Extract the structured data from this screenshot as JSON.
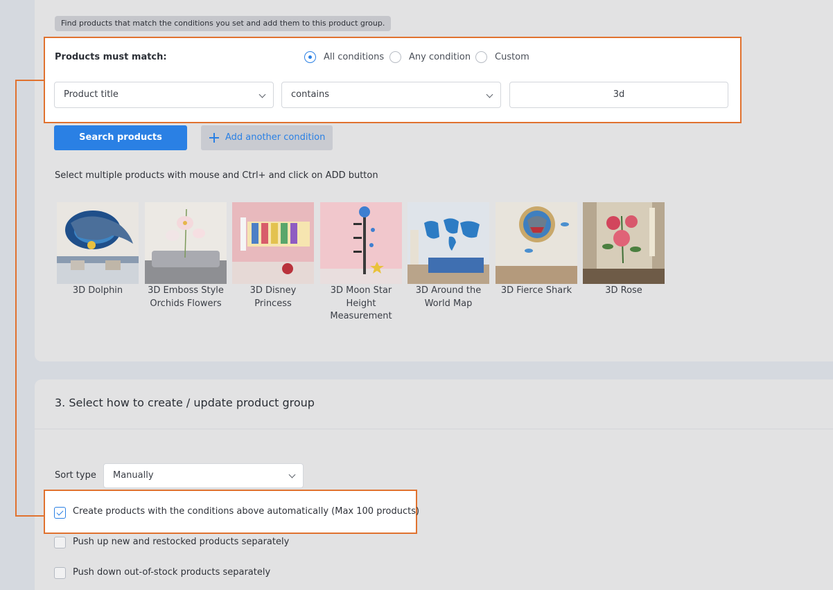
{
  "header": {
    "hint": "Find products that match the conditions you set and add them to this product group."
  },
  "conditions": {
    "match_label": "Products must match:",
    "match_options": [
      {
        "label": "All conditions",
        "selected": true
      },
      {
        "label": "Any condition",
        "selected": false
      },
      {
        "label": "Custom",
        "selected": false
      }
    ],
    "field_value": "Product title",
    "operator_value": "contains",
    "value": "3d"
  },
  "actions": {
    "search_label": "Search products",
    "add_condition_label": "Add another condition"
  },
  "results": {
    "hint": "Select multiple products with mouse and Ctrl+ and click on ADD button",
    "products": [
      {
        "name": "3D Dolphin"
      },
      {
        "name": "3D Emboss Style Orchids Flowers"
      },
      {
        "name": "3D Disney Princess"
      },
      {
        "name": "3D Moon Star Height Measurement"
      },
      {
        "name": "3D Around the World Map"
      },
      {
        "name": "3D Fierce Shark"
      },
      {
        "name": "3D Rose"
      }
    ]
  },
  "section3": {
    "title": "3. Select how to create / update product group",
    "sort_label": "Sort type",
    "sort_value": "Manually",
    "options": [
      {
        "label": "Create products with the conditions above automatically (Max 100 products)",
        "checked": true
      },
      {
        "label": "Push up new and restocked products separately",
        "checked": false
      },
      {
        "label": "Push down out-of-stock products separately",
        "checked": false
      }
    ]
  },
  "colors": {
    "accent": "#2a80e4",
    "highlight": "#e0722f"
  }
}
